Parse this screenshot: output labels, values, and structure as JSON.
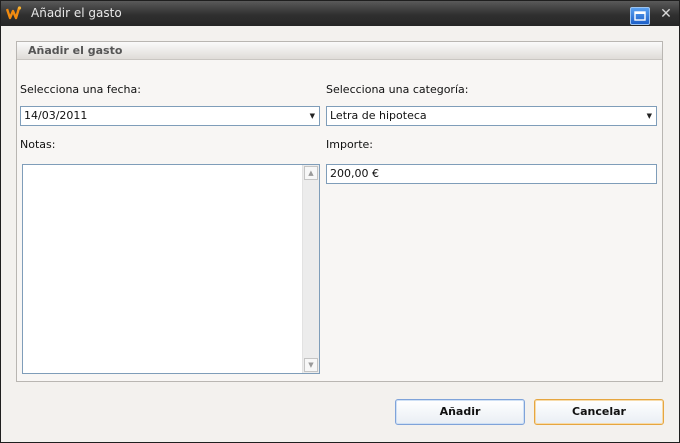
{
  "window": {
    "title": "Añadir el gasto"
  },
  "titlebar": {
    "close_glyph": "✕"
  },
  "group": {
    "title": "Añadir el gasto"
  },
  "form": {
    "date_label": "Selecciona una fecha:",
    "date_value": "14/03/2011",
    "category_label": "Selecciona una categoría:",
    "category_value": "Letra de hipoteca",
    "notes_label": "Notas:",
    "notes_value": "",
    "amount_label": "Importe:",
    "amount_value": "200,00 €"
  },
  "buttons": {
    "add": "Añadir",
    "cancel": "Cancelar"
  },
  "icons": {
    "app": "app-logo-icon",
    "restore": "restore-window-icon",
    "close": "close-icon",
    "dropdown": "chevron-down-icon",
    "scroll_up": "scroll-up-arrow-icon",
    "scroll_down": "scroll-down-arrow-icon"
  },
  "colors": {
    "add_border": "#7fa3d9",
    "cancel_border": "#e6a640",
    "title_bar": "#303030",
    "field_border": "#7f9db9"
  }
}
